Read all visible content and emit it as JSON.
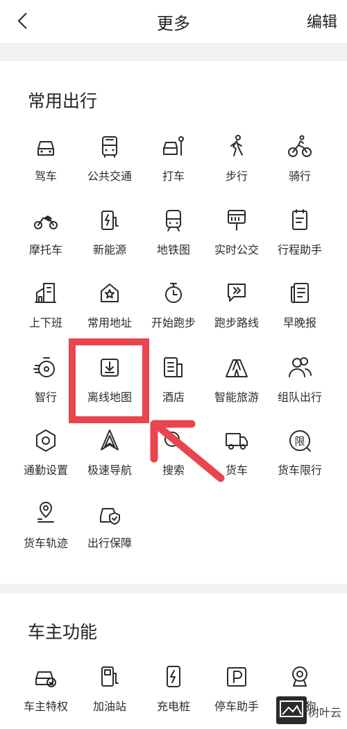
{
  "header": {
    "title": "更多",
    "edit_label": "编辑",
    "back_icon": "chevron-left-icon"
  },
  "sections": {
    "common_travel": {
      "title": "常用出行",
      "items": [
        {
          "label": "驾车",
          "icon": "car-icon"
        },
        {
          "label": "公共交通",
          "icon": "bus-icon"
        },
        {
          "label": "打车",
          "icon": "taxi-person-icon"
        },
        {
          "label": "步行",
          "icon": "walking-person-icon"
        },
        {
          "label": "骑行",
          "icon": "cyclist-icon"
        },
        {
          "label": "摩托车",
          "icon": "motorcycle-icon"
        },
        {
          "label": "新能源",
          "icon": "charging-pile-icon"
        },
        {
          "label": "地铁图",
          "icon": "subway-icon"
        },
        {
          "label": "实时公交",
          "icon": "bus-stop-sign-icon"
        },
        {
          "label": "行程助手",
          "icon": "clipboard-icon"
        },
        {
          "label": "上下班",
          "icon": "buildings-icon"
        },
        {
          "label": "常用地址",
          "icon": "house-star-icon"
        },
        {
          "label": "开始跑步",
          "icon": "stopwatch-icon"
        },
        {
          "label": "跑步路线",
          "icon": "route-flag-icon"
        },
        {
          "label": "早晚报",
          "icon": "newspaper-icon"
        },
        {
          "label": "智行",
          "icon": "speed-timer-icon"
        },
        {
          "label": "离线地图",
          "icon": "download-box-icon"
        },
        {
          "label": "酒店",
          "icon": "hotel-icon"
        },
        {
          "label": "智能旅游",
          "icon": "tent-icon"
        },
        {
          "label": "组队出行",
          "icon": "group-people-icon"
        },
        {
          "label": "通勤设置",
          "icon": "hexagon-gear-icon"
        },
        {
          "label": "极速导航",
          "icon": "navigation-arrow-icon"
        },
        {
          "label": "搜索",
          "icon": "search-icon"
        },
        {
          "label": "货车",
          "icon": "truck-icon"
        },
        {
          "label": "货车限行",
          "icon": "restriction-sign-icon"
        },
        {
          "label": "货车轨迹",
          "icon": "location-track-icon"
        },
        {
          "label": "出行保障",
          "icon": "car-shield-icon"
        }
      ]
    },
    "owner": {
      "title": "车主功能",
      "items": [
        {
          "label": "车主特权",
          "icon": "car-badge-icon"
        },
        {
          "label": "加油站",
          "icon": "gas-station-icon"
        },
        {
          "label": "充电桩",
          "icon": "charger-icon"
        },
        {
          "label": "停车助手",
          "icon": "parking-icon"
        },
        {
          "label": "...子狗",
          "icon": "dashcam-icon"
        }
      ]
    }
  },
  "watermark": {
    "text": "树叶云"
  },
  "colors": {
    "highlight": "#e8454f",
    "arrow": "#e8454f",
    "gap": "#f2f2f4"
  }
}
